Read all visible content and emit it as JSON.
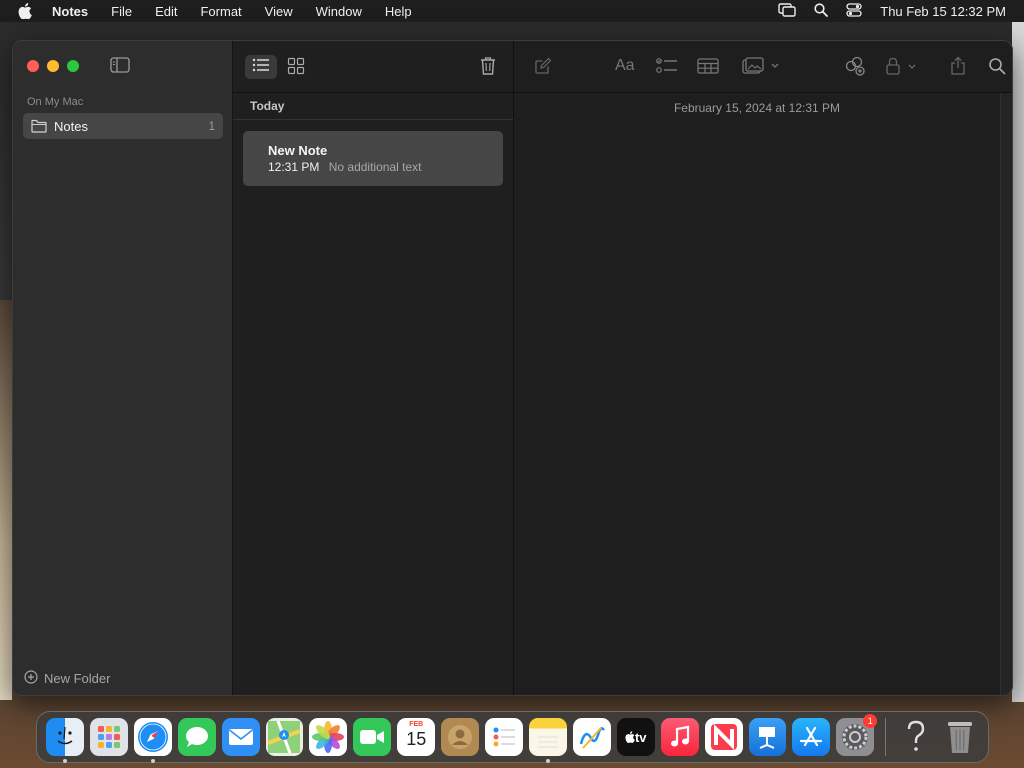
{
  "menubar": {
    "app_name": "Notes",
    "menus": [
      "File",
      "Edit",
      "Format",
      "View",
      "Window",
      "Help"
    ],
    "clock": "Thu Feb 15  12:32 PM"
  },
  "sidebar": {
    "section_label": "On My Mac",
    "folders": [
      {
        "label": "Notes",
        "count": "1"
      }
    ],
    "new_folder_label": "New Folder"
  },
  "notelist": {
    "group_header": "Today",
    "notes": [
      {
        "title": "New Note",
        "time": "12:31 PM",
        "preview": "No additional text"
      }
    ]
  },
  "editor": {
    "date": "February 15, 2024 at 12:31 PM",
    "format_label": "Aa"
  },
  "dock": {
    "items": [
      {
        "name": "finder-icon",
        "running": true
      },
      {
        "name": "launchpad-icon",
        "running": false
      },
      {
        "name": "safari-icon",
        "running": true
      },
      {
        "name": "messages-icon",
        "running": false
      },
      {
        "name": "mail-icon",
        "running": false
      },
      {
        "name": "maps-icon",
        "running": false
      },
      {
        "name": "photos-icon",
        "running": false
      },
      {
        "name": "facetime-icon",
        "running": false
      },
      {
        "name": "calendar-icon",
        "running": false
      },
      {
        "name": "contacts-icon",
        "running": false
      },
      {
        "name": "reminders-icon",
        "running": false
      },
      {
        "name": "notes-icon",
        "running": true
      },
      {
        "name": "freeform-icon",
        "running": false
      },
      {
        "name": "apple-tv-icon",
        "running": false
      },
      {
        "name": "music-icon",
        "running": false
      },
      {
        "name": "news-icon",
        "running": false
      },
      {
        "name": "keynote-icon",
        "running": false
      },
      {
        "name": "app-store-icon",
        "running": false
      },
      {
        "name": "system-settings-icon",
        "running": false
      }
    ],
    "calendar_month": "FEB",
    "calendar_day": "15",
    "tv_label": "tv",
    "settings_badge": "1"
  },
  "colors": {
    "accent_close": "#ff5f57",
    "accent_min": "#febc2e",
    "accent_max": "#28c840",
    "selection": "#464646"
  }
}
